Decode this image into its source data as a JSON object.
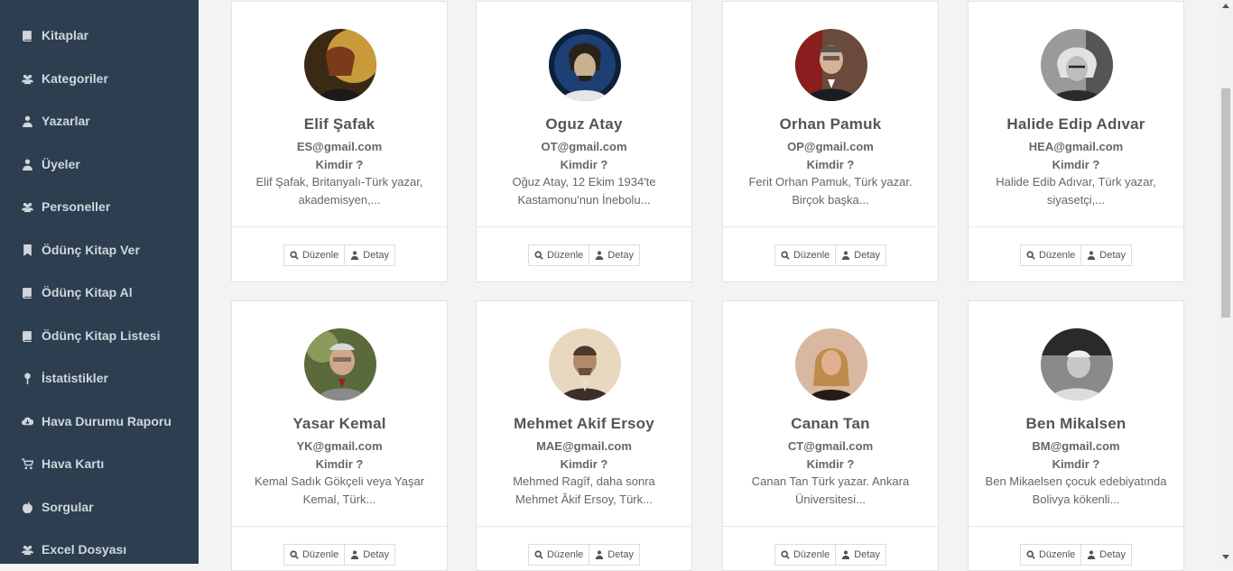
{
  "sidebar": {
    "items": [
      {
        "label": "Kitaplar",
        "icon": "book-icon"
      },
      {
        "label": "Kategoriler",
        "icon": "users-icon"
      },
      {
        "label": "Yazarlar",
        "icon": "user-icon"
      },
      {
        "label": "Üyeler",
        "icon": "user-icon"
      },
      {
        "label": "Personeller",
        "icon": "users-icon"
      },
      {
        "label": "Ödünç Kitap Ver",
        "icon": "bookmark-icon"
      },
      {
        "label": "Ödünç Kitap Al",
        "icon": "book-icon"
      },
      {
        "label": "Ödünç Kitap Listesi",
        "icon": "book-icon"
      },
      {
        "label": "İstatistikler",
        "icon": "map-pin-icon"
      },
      {
        "label": "Hava Durumu Raporu",
        "icon": "cloud-download-icon"
      },
      {
        "label": "Hava Kartı",
        "icon": "shopping-cart-icon"
      },
      {
        "label": "Sorgular",
        "icon": "apple-icon"
      },
      {
        "label": "Excel Dosyası",
        "icon": "users-icon"
      }
    ]
  },
  "authors": [
    {
      "name": "Elif Şafak",
      "email": "ES@gmail.com",
      "who_label": "Kimdir ?",
      "bio": "Elif Şafak, Britanyalı-Türk yazar, akademisyen,...",
      "edit_label": "Düzenle",
      "detail_label": "Detay"
    },
    {
      "name": "Oguz Atay",
      "email": "OT@gmail.com",
      "who_label": "Kimdir ?",
      "bio": "Oğuz Atay, 12 Ekim 1934'te Kastamonu'nun İnebolu...",
      "edit_label": "Düzenle",
      "detail_label": "Detay"
    },
    {
      "name": "Orhan Pamuk",
      "email": "OP@gmail.com",
      "who_label": "Kimdir ?",
      "bio": "Ferit Orhan Pamuk, Türk yazar. Birçok başka...",
      "edit_label": "Düzenle",
      "detail_label": "Detay"
    },
    {
      "name": "Halide Edip Adıvar",
      "email": "HEA@gmail.com",
      "who_label": "Kimdir ?",
      "bio": "Halide Edib Adıvar, Türk yazar, siyasetçi,...",
      "edit_label": "Düzenle",
      "detail_label": "Detay"
    },
    {
      "name": "Yasar Kemal",
      "email": "YK@gmail.com",
      "who_label": "Kimdir ?",
      "bio": "Kemal Sadık Gökçeli veya Yaşar Kemal, Türk...",
      "edit_label": "Düzenle",
      "detail_label": "Detay"
    },
    {
      "name": "Mehmet Akif Ersoy",
      "email": "MAE@gmail.com",
      "who_label": "Kimdir ?",
      "bio": "Mehmed Ragîf, daha sonra Mehmet Âkif Ersoy, Türk...",
      "edit_label": "Düzenle",
      "detail_label": "Detay"
    },
    {
      "name": "Canan Tan",
      "email": "CT@gmail.com",
      "who_label": "Kimdir ?",
      "bio": "Canan Tan Türk yazar. Ankara Üniversitesi...",
      "edit_label": "Düzenle",
      "detail_label": "Detay"
    },
    {
      "name": "Ben Mikalsen",
      "email": "BM@gmail.com",
      "who_label": "Kimdir ?",
      "bio": "Ben Mikaelsen çocuk edebiyatında Bolivya kökenli...",
      "edit_label": "Düzenle",
      "detail_label": "Detay"
    }
  ],
  "colors": {
    "sidebar_bg": "#2c3e50",
    "sidebar_text": "#d0d6dc",
    "page_bg": "#f3f3f3",
    "card_bg": "#ffffff"
  }
}
